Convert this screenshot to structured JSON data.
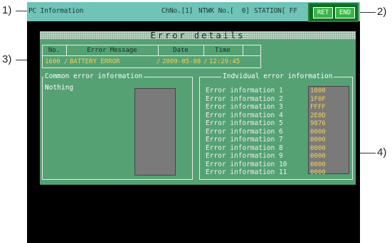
{
  "callouts": {
    "c1": "1)",
    "c2": "2)",
    "c3": "3)",
    "c4": "4)"
  },
  "titlebar": {
    "title": "PC Information",
    "channel": "ChNo.[1]",
    "network": "NTWK No.[  0]",
    "station": "STATION[ FF",
    "buttons": {
      "ret": "RET",
      "end": "END"
    }
  },
  "panel": {
    "title": "Error details",
    "table": {
      "headers": [
        "No.",
        "Error Message",
        "Date",
        "Time"
      ],
      "row": {
        "no": "1600",
        "message": "BATTERY ERROR",
        "date": "2009-05-08",
        "time": "12:29:45"
      },
      "separators": [
        "/",
        "/",
        "/"
      ]
    },
    "common": {
      "title": "Common error information",
      "text": "Nothing"
    },
    "individual": {
      "title": "Indvidual error information",
      "items": [
        {
          "label": "Error information 1",
          "value": "1000"
        },
        {
          "label": "Error information 2",
          "value": "1F0F"
        },
        {
          "label": "Error information 3",
          "value": "FFFF"
        },
        {
          "label": "Error information 4",
          "value": "2E0D"
        },
        {
          "label": "Error information 5",
          "value": "9876"
        },
        {
          "label": "Error information 6",
          "value": "0000"
        },
        {
          "label": "Error information 7",
          "value": "0000"
        },
        {
          "label": "Error information 8",
          "value": "0000"
        },
        {
          "label": "Error information 9",
          "value": "0000"
        },
        {
          "label": "Error information 10",
          "value": "0000"
        },
        {
          "label": "Error information 11",
          "value": "0000"
        }
      ]
    }
  },
  "colors": {
    "titlebar": "#6fc3b7",
    "panel": "#55a174",
    "value_text": "#f2d35c",
    "button": "#3ab54a"
  }
}
